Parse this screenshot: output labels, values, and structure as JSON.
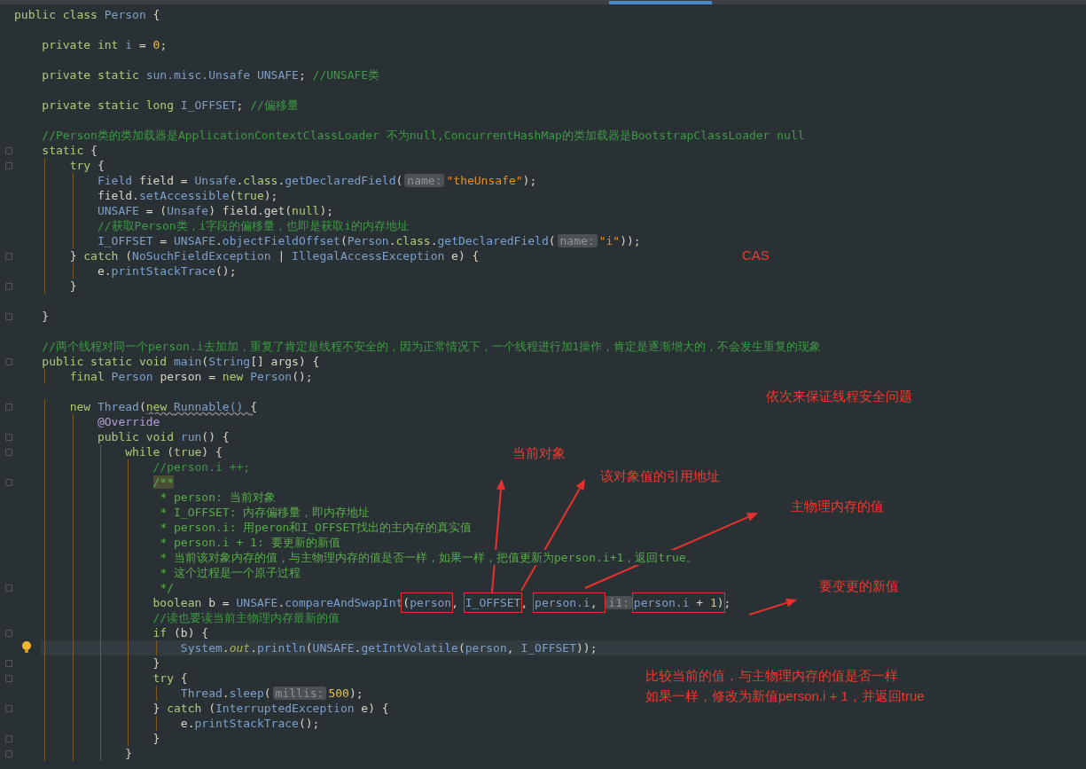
{
  "lines": [
    {
      "kind": "code",
      "fold": false,
      "current": false,
      "bulb": false,
      "tokens": [
        {
          "kind": "keyword",
          "text": "public class "
        },
        {
          "kind": "type",
          "text": "Person "
        },
        {
          "kind": "plain",
          "text": "{"
        }
      ]
    },
    {
      "kind": "blank"
    },
    {
      "kind": "code",
      "fold": false,
      "current": false,
      "bulb": false,
      "tokens": [
        {
          "kind": "keyword",
          "text": "    private int "
        },
        {
          "kind": "type",
          "text": "i"
        },
        {
          "kind": "plain",
          "text": " = "
        },
        {
          "kind": "number",
          "text": "0"
        },
        {
          "kind": "plain",
          "text": ";"
        }
      ]
    },
    {
      "kind": "blank"
    },
    {
      "kind": "code",
      "fold": false,
      "current": false,
      "bulb": false,
      "tokens": [
        {
          "kind": "keyword",
          "text": "    private static "
        },
        {
          "kind": "type",
          "text": "sun.misc.Unsafe UNSAFE"
        },
        {
          "kind": "plain",
          "text": "; "
        },
        {
          "kind": "comment",
          "text": "//UNSAFE类"
        }
      ]
    },
    {
      "kind": "blank"
    },
    {
      "kind": "code",
      "fold": false,
      "current": false,
      "bulb": false,
      "tokens": [
        {
          "kind": "keyword",
          "text": "    private static long "
        },
        {
          "kind": "type",
          "text": "I_OFFSET"
        },
        {
          "kind": "plain",
          "text": "; "
        },
        {
          "kind": "comment",
          "text": "//偏移量"
        }
      ]
    },
    {
      "kind": "blank"
    },
    {
      "kind": "code",
      "fold": false,
      "current": false,
      "bulb": false,
      "tokens": [
        {
          "kind": "comment",
          "text": "    //Person类的类加载器是ApplicationContextClassLoader 不为null,ConcurrentHashMap的类加载器是BootstrapClassLoader null"
        }
      ]
    },
    {
      "kind": "code",
      "fold": true,
      "current": false,
      "bulb": false,
      "tokens": [
        {
          "kind": "keyword",
          "text": "    static "
        },
        {
          "kind": "plain",
          "text": "{"
        }
      ]
    },
    {
      "kind": "code",
      "fold": true,
      "current": false,
      "bulb": false,
      "tokens": [
        {
          "kind": "keyword",
          "text": "        try "
        },
        {
          "kind": "plain",
          "text": "{"
        }
      ]
    },
    {
      "kind": "code",
      "fold": false,
      "current": false,
      "bulb": false,
      "tokens": [
        {
          "kind": "type",
          "text": "            Field "
        },
        {
          "kind": "plain",
          "text": "field = "
        },
        {
          "kind": "type",
          "text": "Unsafe"
        },
        {
          "kind": "plain",
          "text": "."
        },
        {
          "kind": "keyword",
          "text": "class"
        },
        {
          "kind": "plain",
          "text": "."
        },
        {
          "kind": "method",
          "text": "getDeclaredField"
        },
        {
          "kind": "plain",
          "text": "("
        },
        {
          "kind": "hint",
          "text": "name:"
        },
        {
          "kind": "string",
          "text": "\"theUnsafe\""
        },
        {
          "kind": "plain",
          "text": ");"
        }
      ]
    },
    {
      "kind": "code",
      "fold": false,
      "current": false,
      "bulb": false,
      "tokens": [
        {
          "kind": "plain",
          "text": "            field."
        },
        {
          "kind": "method",
          "text": "setAccessible"
        },
        {
          "kind": "plain",
          "text": "("
        },
        {
          "kind": "keyword",
          "text": "true"
        },
        {
          "kind": "plain",
          "text": ");"
        }
      ]
    },
    {
      "kind": "code",
      "fold": false,
      "current": false,
      "bulb": false,
      "tokens": [
        {
          "kind": "type",
          "text": "            UNSAFE"
        },
        {
          "kind": "plain",
          "text": " = ("
        },
        {
          "kind": "type",
          "text": "Unsafe"
        },
        {
          "kind": "plain",
          "text": ") field.get("
        },
        {
          "kind": "keyword",
          "text": "null"
        },
        {
          "kind": "plain",
          "text": ");"
        }
      ]
    },
    {
      "kind": "code",
      "fold": false,
      "current": false,
      "bulb": false,
      "tokens": [
        {
          "kind": "comment",
          "text": "            //获取Person类，i字段的偏移量，也即是获取i的内存地址"
        }
      ]
    },
    {
      "kind": "code",
      "fold": false,
      "current": false,
      "bulb": false,
      "tokens": [
        {
          "kind": "type",
          "text": "            I_OFFSET"
        },
        {
          "kind": "plain",
          "text": " = "
        },
        {
          "kind": "type",
          "text": "UNSAFE"
        },
        {
          "kind": "plain",
          "text": "."
        },
        {
          "kind": "method",
          "text": "objectFieldOffset"
        },
        {
          "kind": "plain",
          "text": "("
        },
        {
          "kind": "type",
          "text": "Person"
        },
        {
          "kind": "plain",
          "text": "."
        },
        {
          "kind": "keyword",
          "text": "class"
        },
        {
          "kind": "plain",
          "text": "."
        },
        {
          "kind": "method",
          "text": "getDeclaredField"
        },
        {
          "kind": "plain",
          "text": "("
        },
        {
          "kind": "hint",
          "text": "name:"
        },
        {
          "kind": "string",
          "text": "\"i\""
        },
        {
          "kind": "plain",
          "text": "));"
        }
      ]
    },
    {
      "kind": "code",
      "fold": true,
      "current": false,
      "bulb": false,
      "tokens": [
        {
          "kind": "plain",
          "text": "        } "
        },
        {
          "kind": "keyword",
          "text": "catch "
        },
        {
          "kind": "plain",
          "text": "("
        },
        {
          "kind": "type",
          "text": "NoSuchFieldException"
        },
        {
          "kind": "plain",
          "text": " | "
        },
        {
          "kind": "type",
          "text": "IllegalAccessException"
        },
        {
          "kind": "plain",
          "text": " e) {"
        }
      ]
    },
    {
      "kind": "code",
      "fold": false,
      "current": false,
      "bulb": false,
      "tokens": [
        {
          "kind": "plain",
          "text": "            e."
        },
        {
          "kind": "method",
          "text": "printStackTrace"
        },
        {
          "kind": "plain",
          "text": "();"
        }
      ]
    },
    {
      "kind": "code",
      "fold": true,
      "current": false,
      "bulb": false,
      "tokens": [
        {
          "kind": "plain",
          "text": "        }"
        }
      ]
    },
    {
      "kind": "blank"
    },
    {
      "kind": "code",
      "fold": true,
      "current": false,
      "bulb": false,
      "tokens": [
        {
          "kind": "plain",
          "text": "    }"
        }
      ]
    },
    {
      "kind": "blank"
    },
    {
      "kind": "code",
      "fold": false,
      "current": false,
      "bulb": false,
      "tokens": [
        {
          "kind": "comment",
          "text": "    //两个线程对同一个person.i去加加，重复了肯定是线程不安全的，因为正常情况下，一个线程进行加1操作，肯定是逐渐增大的，不会发生重复的现象"
        }
      ]
    },
    {
      "kind": "code",
      "fold": true,
      "current": false,
      "bulb": false,
      "tokens": [
        {
          "kind": "keyword",
          "text": "    public static void "
        },
        {
          "kind": "method",
          "text": "main"
        },
        {
          "kind": "plain",
          "text": "("
        },
        {
          "kind": "type",
          "text": "String"
        },
        {
          "kind": "plain",
          "text": "[] args) {"
        }
      ]
    },
    {
      "kind": "code",
      "fold": false,
      "current": false,
      "bulb": false,
      "tokens": [
        {
          "kind": "keyword",
          "text": "        final "
        },
        {
          "kind": "type",
          "text": "Person "
        },
        {
          "kind": "plain",
          "text": "person = "
        },
        {
          "kind": "keyword",
          "text": "new "
        },
        {
          "kind": "type",
          "text": "Person"
        },
        {
          "kind": "plain",
          "text": "();"
        }
      ]
    },
    {
      "kind": "blank"
    },
    {
      "kind": "code",
      "fold": true,
      "current": false,
      "bulb": false,
      "tokens": [
        {
          "kind": "keyword",
          "text": "        new "
        },
        {
          "kind": "type",
          "text": "Thread"
        },
        {
          "kind": "plain",
          "text": "("
        },
        {
          "kind": "keyword",
          "text": "new ",
          "warning": true
        },
        {
          "kind": "type",
          "text": "Runnable() ",
          "warning": true
        },
        {
          "kind": "plain",
          "text": "{",
          "warning": true
        }
      ]
    },
    {
      "kind": "code",
      "fold": false,
      "current": false,
      "bulb": false,
      "tokens": [
        {
          "kind": "annotation",
          "text": "            @Override"
        }
      ]
    },
    {
      "kind": "code",
      "fold": true,
      "current": false,
      "bulb": false,
      "tokens": [
        {
          "kind": "keyword",
          "text": "            public void "
        },
        {
          "kind": "method",
          "text": "run"
        },
        {
          "kind": "plain",
          "text": "() {"
        }
      ]
    },
    {
      "kind": "code",
      "fold": true,
      "current": false,
      "bulb": false,
      "tokens": [
        {
          "kind": "keyword",
          "text": "                while "
        },
        {
          "kind": "plain",
          "text": "("
        },
        {
          "kind": "keyword",
          "text": "true"
        },
        {
          "kind": "plain",
          "text": ") {"
        }
      ]
    },
    {
      "kind": "code",
      "fold": false,
      "current": false,
      "bulb": false,
      "tokens": [
        {
          "kind": "comment",
          "text": "                    //person.i ++;"
        }
      ]
    },
    {
      "kind": "code",
      "fold": true,
      "current": false,
      "bulb": false,
      "tokens": [
        {
          "kind": "doc",
          "text": "                    /**",
          "matched": true
        }
      ]
    },
    {
      "kind": "code",
      "fold": false,
      "current": false,
      "bulb": false,
      "tokens": [
        {
          "kind": "doc",
          "text": "                     * person: 当前对象"
        }
      ]
    },
    {
      "kind": "code",
      "fold": false,
      "current": false,
      "bulb": false,
      "tokens": [
        {
          "kind": "doc",
          "text": "                     * I_OFFSET: 内存偏移量，即内存地址"
        }
      ]
    },
    {
      "kind": "code",
      "fold": false,
      "current": false,
      "bulb": false,
      "tokens": [
        {
          "kind": "doc",
          "text": "                     * person.i: 用peron和I_OFFSET找出的主内存的真实值"
        }
      ]
    },
    {
      "kind": "code",
      "fold": false,
      "current": false,
      "bulb": false,
      "tokens": [
        {
          "kind": "doc",
          "text": "                     * person.i + 1: 要更新的新值"
        }
      ]
    },
    {
      "kind": "code",
      "fold": false,
      "current": false,
      "bulb": false,
      "tokens": [
        {
          "kind": "doc",
          "text": "                     * 当前该对象内存的值，与主物理内存的值是否一样，如果一样，把值更新为person.i+1，返回true。"
        }
      ]
    },
    {
      "kind": "code",
      "fold": false,
      "current": false,
      "bulb": false,
      "tokens": [
        {
          "kind": "doc",
          "text": "                     * 这个过程是一个原子过程"
        }
      ]
    },
    {
      "kind": "code",
      "fold": true,
      "current": false,
      "bulb": false,
      "tokens": [
        {
          "kind": "doc",
          "text": "                     */"
        }
      ]
    },
    {
      "kind": "code",
      "fold": false,
      "current": false,
      "bulb": false,
      "tokens": [
        {
          "kind": "keyword",
          "text": "                    boolean "
        },
        {
          "kind": "plain",
          "text": "b = "
        },
        {
          "kind": "type",
          "text": "UNSAFE"
        },
        {
          "kind": "plain",
          "text": "."
        },
        {
          "kind": "method",
          "text": "compareAndSwapInt"
        },
        {
          "kind": "group",
          "boxed": true,
          "parts": [
            {
              "kind": "plain",
              "text": "("
            },
            {
              "kind": "type",
              "text": "person"
            }
          ]
        },
        {
          "kind": "plain",
          "text": ", "
        },
        {
          "kind": "type",
          "text": "I_OFFSET",
          "boxed": true
        },
        {
          "kind": "plain",
          "text": ", "
        },
        {
          "kind": "group",
          "boxed": true,
          "parts": [
            {
              "kind": "type",
              "text": "person.i"
            },
            {
              "kind": "plain",
              "text": ", "
            }
          ]
        },
        {
          "kind": "hint",
          "text": "i1:"
        },
        {
          "kind": "group",
          "boxed": true,
          "parts": [
            {
              "kind": "type",
              "text": "person.i"
            },
            {
              "kind": "plain",
              "text": " + "
            },
            {
              "kind": "number",
              "text": "1"
            },
            {
              "kind": "plain",
              "text": ")"
            }
          ]
        },
        {
          "kind": "plain",
          "text": ";"
        }
      ]
    },
    {
      "kind": "code",
      "fold": false,
      "current": false,
      "bulb": false,
      "tokens": [
        {
          "kind": "comment",
          "text": "                    //读也要读当前主物理内存最新的值"
        }
      ]
    },
    {
      "kind": "code",
      "fold": true,
      "current": false,
      "bulb": false,
      "tokens": [
        {
          "kind": "keyword",
          "text": "                    if "
        },
        {
          "kind": "plain",
          "text": "(b) {"
        }
      ]
    },
    {
      "kind": "code",
      "fold": false,
      "current": true,
      "bulb": true,
      "tokens": [
        {
          "kind": "type",
          "text": "                        System"
        },
        {
          "kind": "plain",
          "text": "."
        },
        {
          "kind": "field",
          "text": "out"
        },
        {
          "kind": "plain",
          "text": "."
        },
        {
          "kind": "method",
          "text": "println"
        },
        {
          "kind": "plain",
          "text": "("
        },
        {
          "kind": "type",
          "text": "UNSAFE"
        },
        {
          "kind": "plain",
          "text": "."
        },
        {
          "kind": "method",
          "text": "getIntVolatile"
        },
        {
          "kind": "plain",
          "text": "("
        },
        {
          "kind": "type",
          "text": "person"
        },
        {
          "kind": "plain",
          "text": ", "
        },
        {
          "kind": "type",
          "text": "I_OFFSET"
        },
        {
          "kind": "plain",
          "text": "));"
        }
      ]
    },
    {
      "kind": "code",
      "fold": true,
      "current": false,
      "bulb": false,
      "tokens": [
        {
          "kind": "plain",
          "text": "                    }"
        }
      ]
    },
    {
      "kind": "code",
      "fold": true,
      "current": false,
      "bulb": false,
      "tokens": [
        {
          "kind": "keyword",
          "text": "                    try "
        },
        {
          "kind": "plain",
          "text": "{"
        }
      ]
    },
    {
      "kind": "code",
      "fold": false,
      "current": false,
      "bulb": false,
      "tokens": [
        {
          "kind": "type",
          "text": "                        Thread"
        },
        {
          "kind": "plain",
          "text": "."
        },
        {
          "kind": "method",
          "text": "sleep"
        },
        {
          "kind": "plain",
          "text": "("
        },
        {
          "kind": "hint",
          "text": "millis:"
        },
        {
          "kind": "number",
          "text": "500"
        },
        {
          "kind": "plain",
          "text": ");"
        }
      ]
    },
    {
      "kind": "code",
      "fold": true,
      "current": false,
      "bulb": false,
      "tokens": [
        {
          "kind": "plain",
          "text": "                    } "
        },
        {
          "kind": "keyword",
          "text": "catch "
        },
        {
          "kind": "plain",
          "text": "("
        },
        {
          "kind": "type",
          "text": "InterruptedException"
        },
        {
          "kind": "plain",
          "text": " e) {"
        }
      ]
    },
    {
      "kind": "code",
      "fold": false,
      "current": false,
      "bulb": false,
      "tokens": [
        {
          "kind": "plain",
          "text": "                        e."
        },
        {
          "kind": "method",
          "text": "printStackTrace"
        },
        {
          "kind": "plain",
          "text": "();"
        }
      ]
    },
    {
      "kind": "code",
      "fold": true,
      "current": false,
      "bulb": false,
      "tokens": [
        {
          "kind": "plain",
          "text": "                    }"
        }
      ]
    },
    {
      "kind": "code",
      "fold": true,
      "current": false,
      "bulb": false,
      "tokens": [
        {
          "kind": "plain",
          "text": "                }"
        }
      ]
    }
  ],
  "annotations": [
    {
      "text": "CAS"
    },
    {
      "text": "依次来保证线程安全问题"
    },
    {
      "text": "当前对象"
    },
    {
      "text": "该对象值的引用地址"
    },
    {
      "text": "主物理内存的值"
    },
    {
      "text": "要变更的新值"
    },
    {
      "text": "比较当前的值，与主物理内存的值是否一样"
    },
    {
      "text": "如果一样，修改为新值person.i + 1，并返回true"
    }
  ]
}
